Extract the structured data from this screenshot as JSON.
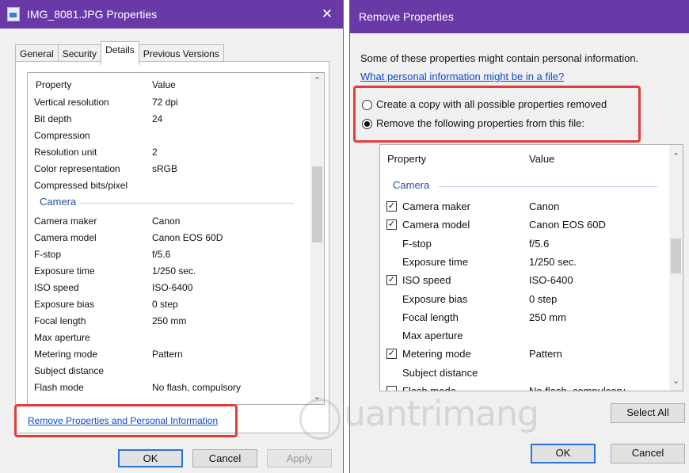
{
  "left_window": {
    "title": "IMG_8081.JPG Properties",
    "close": "✕",
    "tabs": [
      "General",
      "Security",
      "Details",
      "Previous Versions"
    ],
    "active_tab": "Details",
    "list": {
      "header_property": "Property",
      "header_value": "Value",
      "rows_before_group": [
        {
          "property": "Vertical resolution",
          "value": "72 dpi"
        },
        {
          "property": "Bit depth",
          "value": "24"
        },
        {
          "property": "Compression",
          "value": ""
        },
        {
          "property": "Resolution unit",
          "value": "2"
        },
        {
          "property": "Color representation",
          "value": "sRGB"
        },
        {
          "property": "Compressed bits/pixel",
          "value": ""
        }
      ],
      "group": "Camera",
      "rows_after_group": [
        {
          "property": "Camera maker",
          "value": "Canon"
        },
        {
          "property": "Camera model",
          "value": "Canon EOS 60D"
        },
        {
          "property": "F-stop",
          "value": "f/5.6"
        },
        {
          "property": "Exposure time",
          "value": "1/250 sec."
        },
        {
          "property": "ISO speed",
          "value": "ISO-6400"
        },
        {
          "property": "Exposure bias",
          "value": "0 step"
        },
        {
          "property": "Focal length",
          "value": "250 mm"
        },
        {
          "property": "Max aperture",
          "value": ""
        },
        {
          "property": "Metering mode",
          "value": "Pattern"
        },
        {
          "property": "Subject distance",
          "value": ""
        },
        {
          "property": "Flash mode",
          "value": "No flash, compulsory"
        }
      ]
    },
    "remove_link": "Remove Properties and Personal Information",
    "buttons": {
      "ok": "OK",
      "cancel": "Cancel",
      "apply": "Apply"
    }
  },
  "right_window": {
    "title": "Remove Properties",
    "description": "Some of these properties might contain personal information.",
    "help_link": "What personal information might be in a file?",
    "options": [
      {
        "label": "Create a copy with all possible properties removed",
        "selected": false
      },
      {
        "label": "Remove the following properties from this file:",
        "selected": true
      }
    ],
    "list": {
      "header_property": "Property",
      "header_value": "Value",
      "group": "Camera",
      "rows": [
        {
          "property": "Camera maker",
          "value": "Canon",
          "checkbox": true,
          "checked": true
        },
        {
          "property": "Camera model",
          "value": "Canon EOS 60D",
          "checkbox": true,
          "checked": true
        },
        {
          "property": "F-stop",
          "value": "f/5.6",
          "checkbox": false,
          "checked": false
        },
        {
          "property": "Exposure time",
          "value": "1/250 sec.",
          "checkbox": false,
          "checked": false
        },
        {
          "property": "ISO speed",
          "value": "ISO-6400",
          "checkbox": true,
          "checked": true
        },
        {
          "property": "Exposure bias",
          "value": "0 step",
          "checkbox": false,
          "checked": false
        },
        {
          "property": "Focal length",
          "value": "250 mm",
          "checkbox": false,
          "checked": false
        },
        {
          "property": "Max aperture",
          "value": "",
          "checkbox": false,
          "checked": false
        },
        {
          "property": "Metering mode",
          "value": "Pattern",
          "checkbox": true,
          "checked": true
        },
        {
          "property": "Subject distance",
          "value": "",
          "checkbox": false,
          "checked": false
        },
        {
          "property": "Flash mode",
          "value": "No flash, compulsory",
          "checkbox": true,
          "checked": false
        }
      ]
    },
    "buttons": {
      "select_all": "Select All",
      "ok": "OK",
      "cancel": "Cancel"
    }
  },
  "watermark": "uantrimang",
  "colors": {
    "titlebar": "#6a39a8",
    "highlight_box": "#e53b3b",
    "link": "#0b4bd3",
    "group_text": "#1f4e99"
  }
}
